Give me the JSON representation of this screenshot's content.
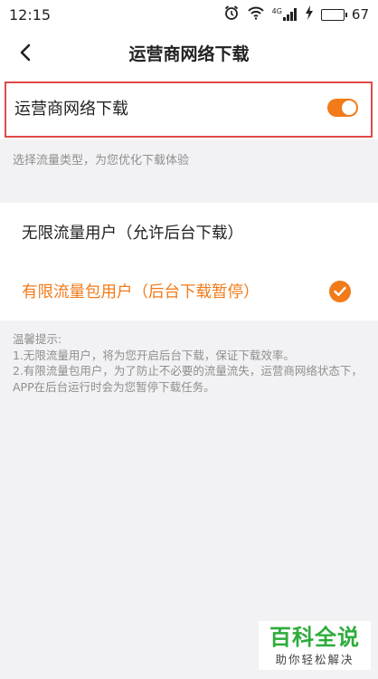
{
  "status_bar": {
    "time": "12:15",
    "network": "4G",
    "battery": "67",
    "battery_level": 0.67
  },
  "header": {
    "title": "运营商网络下载"
  },
  "toggle": {
    "label": "运营商网络下载",
    "on": true
  },
  "hint": "选择流量类型，为您优化下载体验",
  "options": [
    {
      "label": "无限流量用户（允许后台下载）",
      "selected": false
    },
    {
      "label": "有限流量包用户（后台下载暂停）",
      "selected": true
    }
  ],
  "notes": {
    "title": "温馨提示:",
    "line1": "1.无限流量用户，将为您开启后台下载，保证下载效率。",
    "line2": "2.有限流量包用户，为了防止不必要的流量流失，运营商网络状态下，APP在后台运行时会为您暂停下载任务。"
  },
  "watermark": {
    "title": "百科全说",
    "subtitle": "助你轻松解决"
  },
  "colors": {
    "accent": "#f27a19",
    "outline": "#e14a4a",
    "battery": "#2bb94c",
    "watermark": "#2eac3a"
  }
}
